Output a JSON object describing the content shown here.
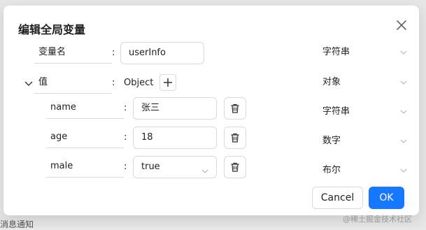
{
  "background": {
    "partial_text": "消息通知"
  },
  "dialog": {
    "title": "编辑全局变量",
    "rows": {
      "root": {
        "name": "变量名",
        "colon": ":",
        "value": "userInfo",
        "type": "字符串"
      },
      "object": {
        "name": "值",
        "colon": ":",
        "value": "Object",
        "type": "对象"
      },
      "children": [
        {
          "name": "name",
          "colon": ":",
          "value": "张三",
          "type": "字符串"
        },
        {
          "name": "age",
          "colon": ":",
          "value": "18",
          "type": "数字"
        },
        {
          "name": "male",
          "colon": ":",
          "value": "true",
          "type": "布尔"
        }
      ]
    },
    "cancel_label": "Cancel",
    "ok_label": "OK"
  },
  "watermark": "@稀土掘金技术社区",
  "colors": {
    "primary": "#1677ff",
    "border": "#d9d9d9",
    "text": "#1f1f1f",
    "arrow": "#bfbfbf"
  }
}
